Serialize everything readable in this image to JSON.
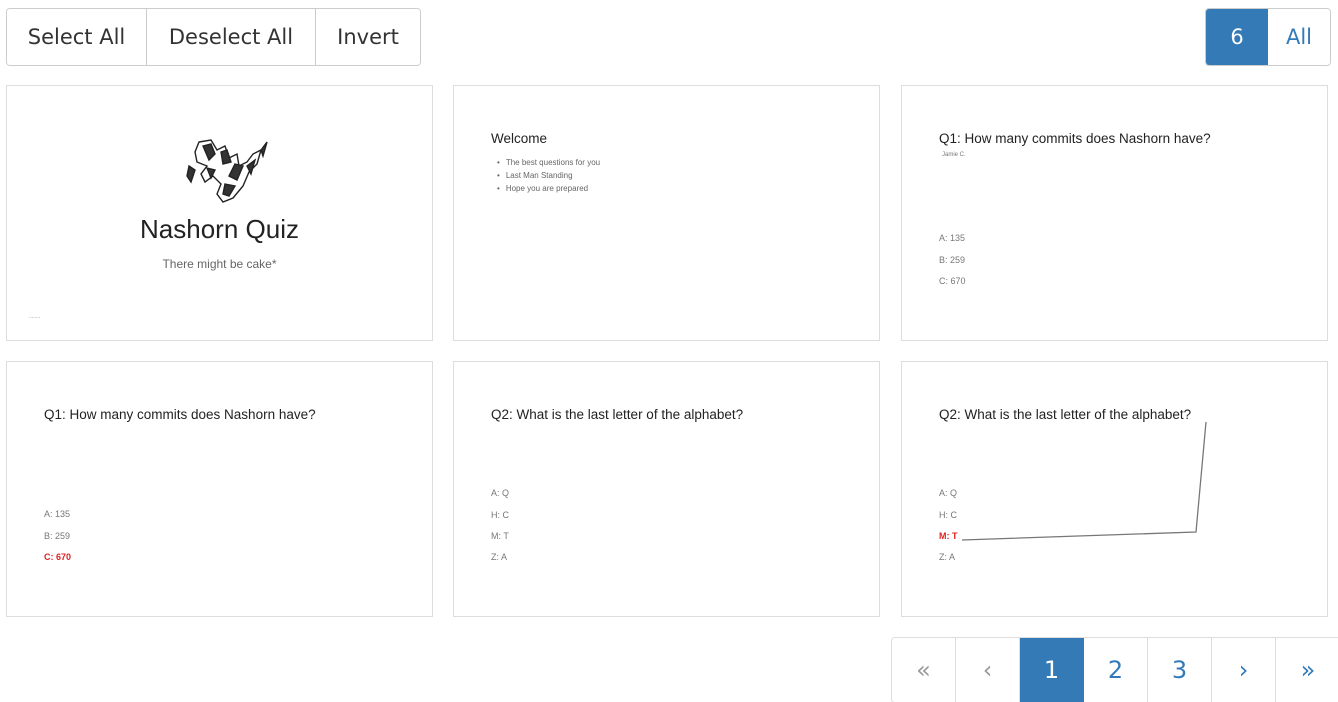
{
  "toolbar": {
    "select_all": "Select All",
    "deselect_all": "Deselect All",
    "invert": "Invert"
  },
  "page_size": {
    "options": [
      "6",
      "All"
    ],
    "selected": "6"
  },
  "slides": [
    {
      "title": "Nashorn Quiz",
      "subtitle": "There might be cake*",
      "logo": "rhino-logo",
      "footnote": "........"
    },
    {
      "title": "Welcome",
      "bullets": [
        "The best questions for you",
        "Last Man Standing",
        "Hope you are prepared"
      ]
    },
    {
      "title": "Q1: How many commits does Nashorn have?",
      "subtext": "Jamie C.",
      "options": [
        "A: 135",
        "B: 259",
        "C: 670"
      ]
    },
    {
      "title": "Q1: How many commits does Nashorn have?",
      "options": [
        "A: 135",
        "B: 259",
        "C: 670"
      ],
      "correct_index": 2
    },
    {
      "title": "Q2: What is the last letter of the alphabet?",
      "options": [
        "A: Q",
        "H: C",
        "M: T",
        "Z: A"
      ]
    },
    {
      "title": "Q2: What is the last letter of the alphabet?",
      "options": [
        "A: Q",
        "H: C",
        "M: T",
        "Z: A"
      ],
      "correct_index": 2
    }
  ],
  "pagination": {
    "first": "«",
    "prev": "‹",
    "pages": [
      "1",
      "2",
      "3"
    ],
    "current": "1",
    "next": "›",
    "last": "»"
  },
  "colors": {
    "accent": "#337ab7",
    "correct": "#e02020"
  }
}
